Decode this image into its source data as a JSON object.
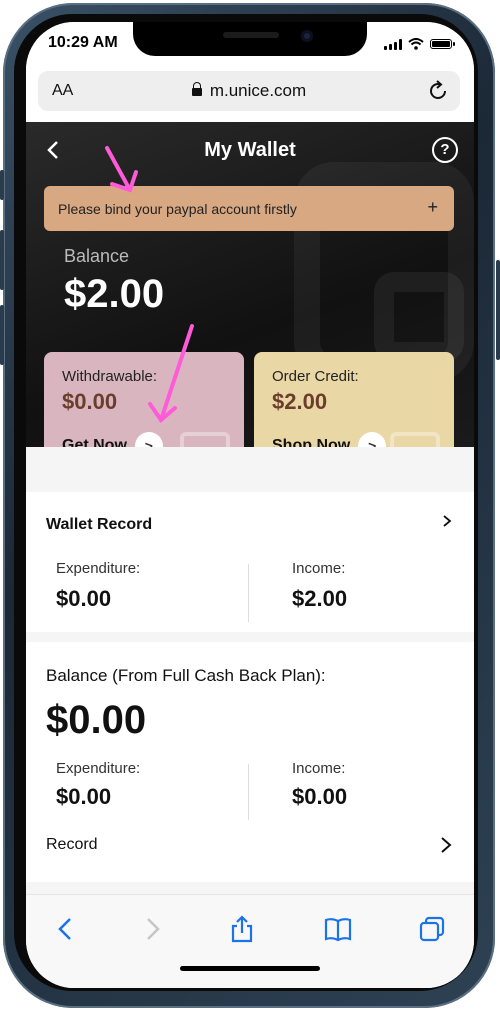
{
  "status_bar": {
    "time": "10:29 AM"
  },
  "browser": {
    "text_size_label": "AA",
    "url": "m.unice.com"
  },
  "header": {
    "title": "My Wallet",
    "help_label": "?"
  },
  "banner": {
    "text": "Please bind your paypal account firstly",
    "plus": "+"
  },
  "balance": {
    "label": "Balance",
    "value": "$2.00"
  },
  "cards": {
    "withdrawable": {
      "label": "Withdrawable:",
      "value": "$0.00",
      "action": "Get Now",
      "arrow": ">"
    },
    "order_credit": {
      "label": "Order Credit:",
      "value": "$2.00",
      "action": "Shop Now",
      "arrow": ">"
    }
  },
  "wallet_record": {
    "title": "Wallet Record",
    "expenditure_label": "Expenditure:",
    "expenditure_value": "$0.00",
    "income_label": "Income:",
    "income_value": "$2.00"
  },
  "cash_back": {
    "title": "Balance (From Full Cash Back Plan):",
    "value": "$0.00",
    "expenditure_label": "Expenditure:",
    "expenditure_value": "$0.00",
    "income_label": "Income:",
    "income_value": "$0.00",
    "record_label": "Record"
  },
  "colors": {
    "banner": "#d8a882",
    "withdrawable_card": "#d9b6bf",
    "order_credit_card": "#ead7a6",
    "annotation_arrow": "#ff5ad8",
    "toolbar_icons": "#1a73e8"
  },
  "icons": [
    "back-chevron-icon",
    "help-icon",
    "plus-icon",
    "lock-icon",
    "reload-icon",
    "chevron-right-icon",
    "share-icon",
    "bookmarks-icon",
    "tabs-icon"
  ]
}
